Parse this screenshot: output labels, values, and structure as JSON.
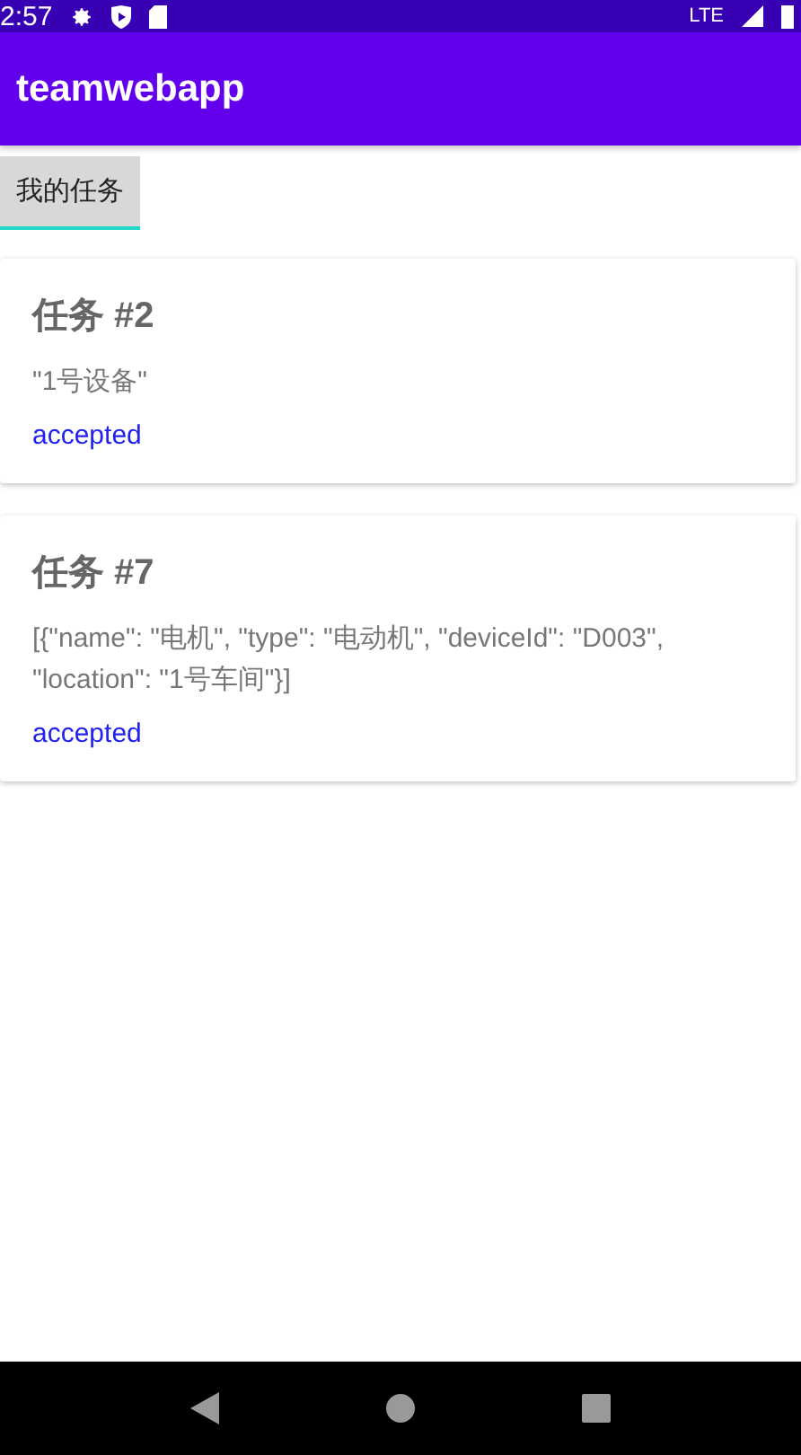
{
  "status_bar": {
    "time": "2:57",
    "network": "LTE"
  },
  "app_bar": {
    "title": "teamwebapp"
  },
  "tabs": [
    {
      "label": "我的任务",
      "selected": true
    }
  ],
  "tasks": [
    {
      "title": "任务 #2",
      "detail": "\"1号设备\"",
      "status": "accepted"
    },
    {
      "title": "任务 #7",
      "detail": "[{\"name\": \"电机\", \"type\": \"电动机\", \"deviceId\": \"D003\", \"location\": \"1号车间\"}]",
      "status": "accepted"
    }
  ]
}
